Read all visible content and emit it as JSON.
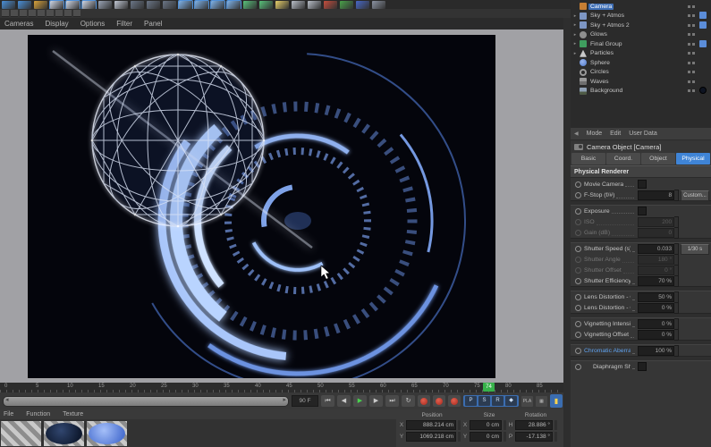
{
  "colors": {
    "accent_blue": "#4a90d9",
    "tab_active": "#3f84d6",
    "record_red": "#c0392b",
    "play_green": "#49d14e",
    "marker_green": "#37b24a",
    "hud_blue": "#8fb4f2",
    "layer_chip_blue": "#5b8dd9"
  },
  "main_toolbar": {
    "icons": [
      {
        "name": "undo-icon",
        "color": "#4a90d9"
      },
      {
        "name": "redo-icon",
        "color": "#4a90d9"
      },
      {
        "name": "live-selection-icon",
        "color": "#d8a23a"
      },
      {
        "name": "move-tool-icon",
        "color": "#cfd6e4",
        "active": true
      },
      {
        "name": "scale-tool-icon",
        "color": "#cfd6e4",
        "active": true
      },
      {
        "name": "rotate-tool-icon",
        "color": "#cfd6e4",
        "active": true
      },
      {
        "name": "last-tool-icon",
        "color": "#9aa4b5"
      },
      {
        "name": "coordinate-system-icon",
        "color": "#c2c8d4"
      },
      {
        "name": "render-view-icon",
        "color": "#6b7687"
      },
      {
        "name": "render-picture-viewer-icon",
        "color": "#6b7687"
      },
      {
        "name": "render-settings-icon",
        "color": "#6b7687"
      },
      {
        "name": "cube-primitive-icon",
        "color": "#7fb2e8",
        "active": true
      },
      {
        "name": "spline-pen-icon",
        "color": "#7fb2e8",
        "active": true
      },
      {
        "name": "subdivision-surface-icon",
        "color": "#7fb2e8",
        "active": true
      },
      {
        "name": "array-modifier-icon",
        "color": "#7fb2e8",
        "active": true
      },
      {
        "name": "floor-environment-icon",
        "color": "#58c27a"
      },
      {
        "name": "scene-camera-icon",
        "color": "#58c27a"
      },
      {
        "name": "light-icon",
        "color": "#e8d06a"
      },
      {
        "name": "material-icon",
        "color": "#b8bec8"
      },
      {
        "name": "snap-icon",
        "color": "#b8bec8"
      },
      {
        "name": "axis-lock-x-icon",
        "color": "#c44d3d"
      },
      {
        "name": "axis-lock-y-icon",
        "color": "#4aa14a"
      },
      {
        "name": "axis-lock-z-icon",
        "color": "#4868c8"
      },
      {
        "name": "workplane-icon",
        "color": "#8b93a2"
      }
    ]
  },
  "secondary_toolbar": {
    "icons": [
      {
        "name": "layout-icon-1"
      },
      {
        "name": "layout-icon-2"
      },
      {
        "name": "layout-icon-3"
      },
      {
        "name": "layout-icon-4"
      },
      {
        "name": "layout-icon-5"
      },
      {
        "name": "layout-icon-6"
      },
      {
        "name": "layout-icon-7"
      },
      {
        "name": "layout-icon-8"
      },
      {
        "name": "layout-icon-9"
      }
    ]
  },
  "viewport": {
    "menu_items": [
      "Cameras",
      "Display",
      "Options",
      "Filter",
      "Panel"
    ]
  },
  "object_manager": {
    "items": [
      {
        "label": "Camera",
        "icon": "camera-icon",
        "selected": true
      },
      {
        "label": "Sky + Atmos",
        "icon": "lp-icon",
        "expander": true,
        "chip": "blue"
      },
      {
        "label": "Sky + Atmos 2",
        "icon": "lp-icon",
        "expander": true,
        "chip": "blue"
      },
      {
        "label": "Glows",
        "icon": "glow-icon",
        "expander": true
      },
      {
        "label": "Final Group",
        "icon": "group-icon",
        "expander": true,
        "chip": "blue"
      },
      {
        "label": "Particles",
        "icon": "particles-icon",
        "expander": true
      },
      {
        "label": "Sphere",
        "icon": "sphere-icon"
      },
      {
        "label": "Circles",
        "icon": "circle-icon"
      },
      {
        "label": "Waves",
        "icon": "wave-icon"
      },
      {
        "label": "Background",
        "icon": "background-icon",
        "chip": "dark-circle"
      }
    ]
  },
  "attribute_manager": {
    "menu_items": [
      "Mode",
      "Edit",
      "User Data"
    ],
    "title": "Camera Object [Camera]",
    "tabs": [
      {
        "label": "Basic",
        "active": false
      },
      {
        "label": "Coord.",
        "active": false
      },
      {
        "label": "Object",
        "active": false
      },
      {
        "label": "Physical",
        "active": true
      }
    ],
    "section_header": "Physical Renderer",
    "rows": [
      {
        "type": "check",
        "label": "Movie Camera",
        "checked": false
      },
      {
        "type": "field",
        "label": "F-Stop (f/#)",
        "value": "8",
        "button": "Custom..."
      },
      {
        "type": "gap"
      },
      {
        "type": "check",
        "label": "Exposure",
        "checked": false
      },
      {
        "type": "field",
        "label": "ISO",
        "value": "200",
        "disabled": true
      },
      {
        "type": "field",
        "label": "Gain (dB)",
        "value": "0",
        "disabled": true
      },
      {
        "type": "gap"
      },
      {
        "type": "field",
        "label": "Shutter Speed (s)",
        "value": "0.033",
        "button": "1/30 s"
      },
      {
        "type": "field",
        "label": "Shutter Angle",
        "value": "180 °",
        "disabled": true
      },
      {
        "type": "field",
        "label": "Shutter Offset",
        "value": "0 °",
        "disabled": true
      },
      {
        "type": "field",
        "label": "Shutter Efficiency",
        "value": "70 %"
      },
      {
        "type": "gap"
      },
      {
        "type": "field",
        "label": "Lens Distortion - Quadratic",
        "value": "50 %"
      },
      {
        "type": "field",
        "label": "Lens Distortion - Cubic",
        "value": "0 %"
      },
      {
        "type": "gap"
      },
      {
        "type": "field",
        "label": "Vignetting Intensity",
        "value": "0 %"
      },
      {
        "type": "field",
        "label": "Vignetting Offset",
        "value": "0 %"
      },
      {
        "type": "gap"
      },
      {
        "type": "field",
        "label": "Chromatic Aberration",
        "value": "100 %",
        "highlight": true
      },
      {
        "type": "gap"
      },
      {
        "type": "check",
        "label": "Diaphragm Shape",
        "checked": false,
        "indent": true
      }
    ]
  },
  "timeline": {
    "ticks": [
      "0",
      "5",
      "10",
      "15",
      "20",
      "25",
      "30",
      "35",
      "40",
      "45",
      "50",
      "55",
      "60",
      "65",
      "70",
      "75",
      "80",
      "85"
    ],
    "current_frame": "74",
    "end_frame": "90 F"
  },
  "transport": {
    "buttons": [
      {
        "name": "goto-start-button",
        "glyph": "⏮"
      },
      {
        "name": "play-backward-button",
        "glyph": "◀"
      },
      {
        "name": "play-button",
        "glyph": "▶",
        "accent": true
      },
      {
        "name": "play-forward-button",
        "glyph": "▶"
      },
      {
        "name": "goto-end-button",
        "glyph": "⏭"
      },
      {
        "name": "loop-mode-button",
        "glyph": "↻"
      }
    ],
    "record_buttons": [
      {
        "name": "record-keyframe-button"
      },
      {
        "name": "autokeying-button"
      },
      {
        "name": "record-active-objects-button"
      }
    ],
    "key_buttons": [
      {
        "name": "record-position-button",
        "glyph": "P"
      },
      {
        "name": "record-scale-button",
        "glyph": "S"
      },
      {
        "name": "record-rotation-button",
        "glyph": "R"
      },
      {
        "name": "record-parameter-button",
        "glyph": "◆"
      }
    ],
    "extra_buttons": [
      {
        "name": "record-pla-button",
        "glyph": "PLA"
      },
      {
        "name": "keyframe-presets-button",
        "glyph": "▦"
      }
    ],
    "marker_button_glyph": "▮"
  },
  "materials": {
    "menu_items": [
      "File",
      "Function",
      "Texture"
    ],
    "swatches": [
      {
        "name": "material-alpha-stripes",
        "kind": "stripes"
      },
      {
        "name": "material-dark-sphere",
        "kind": "dark"
      },
      {
        "name": "material-blue-sphere",
        "kind": "light"
      }
    ]
  },
  "coordinates": {
    "headers": [
      "Position",
      "Size",
      "Rotation"
    ],
    "rows": [
      {
        "pos_axis": "X",
        "pos": "888.214 cm",
        "size_axis": "X",
        "size": "0 cm",
        "rot_axis": "H",
        "rot": "28.886 °"
      },
      {
        "pos_axis": "Y",
        "pos": "1069.218 cm",
        "size_axis": "Y",
        "size": "0 cm",
        "rot_axis": "P",
        "rot": "-17.138 °"
      }
    ]
  }
}
